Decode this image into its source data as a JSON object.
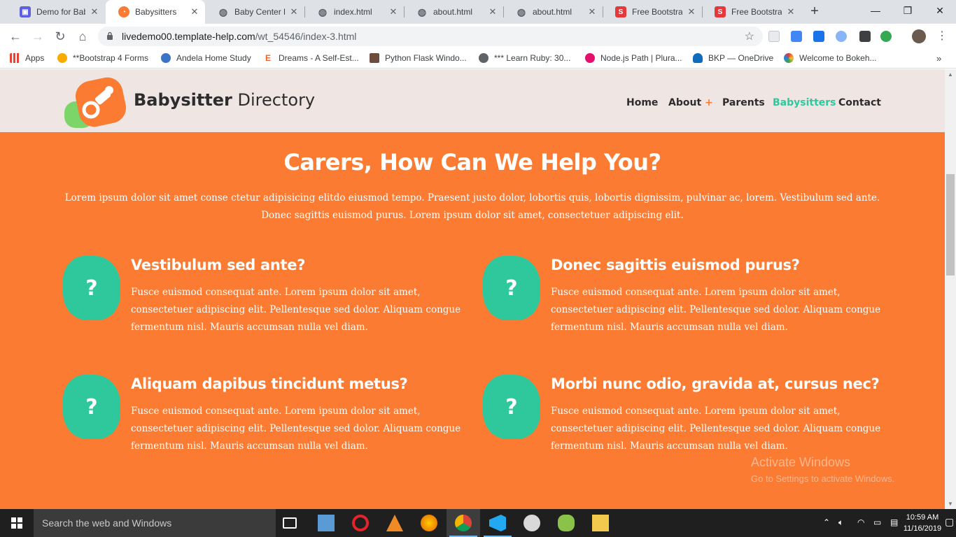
{
  "browser": {
    "tabs": [
      {
        "title": "Demo for Baby",
        "favicon": "template-icon",
        "color": "#5b5fe0"
      },
      {
        "title": "Babysitters",
        "favicon": "babysitter-logo-icon",
        "color": "#fb7b32",
        "active": true
      },
      {
        "title": "Baby Center D",
        "favicon": "globe-icon",
        "color": "#5f6368"
      },
      {
        "title": "index.html",
        "favicon": "globe-icon",
        "color": "#5f6368"
      },
      {
        "title": "about.html",
        "favicon": "globe-icon",
        "color": "#5f6368"
      },
      {
        "title": "about.html",
        "favicon": "globe-icon",
        "color": "#5f6368"
      },
      {
        "title": "Free Bootstrap",
        "favicon": "s-logo-icon",
        "color": "#e5383b"
      },
      {
        "title": "Free Bootstrap",
        "favicon": "s-logo-icon",
        "color": "#e5383b"
      }
    ],
    "url_host": "livedemo00.template-help.com",
    "url_path": "/wt_54546/index-3.html",
    "bookmarks": [
      {
        "label": "Apps",
        "icon": "apps-grid-icon"
      },
      {
        "label": "**Bootstrap 4 Forms",
        "icon": "search-icon"
      },
      {
        "label": "Andela Home Study",
        "icon": "gear-icon"
      },
      {
        "label": "Dreams - A Self-Est...",
        "icon": "e-icon"
      },
      {
        "label": "Python Flask Windo...",
        "icon": "avatar-icon"
      },
      {
        "label": "*** Learn Ruby: 30...",
        "icon": "globe-icon"
      },
      {
        "label": "Node.js Path | Plura...",
        "icon": "pluralsight-icon"
      },
      {
        "label": "BKP — OneDrive",
        "icon": "cloud-icon"
      },
      {
        "label": "Welcome to Bokeh...",
        "icon": "bokeh-icon"
      }
    ]
  },
  "site": {
    "brand_bold": "Babysitter",
    "brand_rest": " Directory",
    "nav": [
      {
        "label": "Home"
      },
      {
        "label": "About",
        "has_submenu": true
      },
      {
        "label": "Parents"
      },
      {
        "label": "Babysitters",
        "active": true
      },
      {
        "label": "Contact"
      }
    ],
    "submenu_marker": "+",
    "section_title": "Carers, How Can We Help You?",
    "section_text": "Lorem ipsum dolor sit amet conse ctetur adipisicing elitdo eiusmod tempo. Praesent justo dolor, lobortis quis, lobortis dignissim, pulvinar ac, lorem. Vestibulum sed ante. Donec sagittis euismod purus. Lorem ipsum dolor sit amet, consectetuer adipiscing elit.",
    "faq_icon": "?",
    "faqs": [
      {
        "title": "Vestibulum sed ante?",
        "text": "Fusce euismod consequat ante. Lorem ipsum dolor sit amet, consectetuer adipiscing elit. Pellentesque sed dolor. Aliquam congue fermentum nisl. Mauris accumsan nulla vel diam."
      },
      {
        "title": "Donec sagittis euismod purus?",
        "text": "Fusce euismod consequat ante. Lorem ipsum dolor sit amet, consectetuer adipiscing elit. Pellentesque sed dolor. Aliquam congue fermentum nisl. Mauris accumsan nulla vel diam."
      },
      {
        "title": "Aliquam dapibus tincidunt metus?",
        "text": "Fusce euismod consequat ante. Lorem ipsum dolor sit amet, consectetuer adipiscing elit. Pellentesque sed dolor. Aliquam congue fermentum nisl. Mauris accumsan nulla vel diam."
      },
      {
        "title": "Morbi nunc odio, gravida at, cursus nec?",
        "text": "Fusce euismod consequat ante. Lorem ipsum dolor sit amet, consectetuer adipiscing elit. Pellentesque sed dolor. Aliquam congue fermentum nisl. Mauris accumsan nulla vel diam."
      }
    ],
    "colors": {
      "orange": "#fb7b32",
      "teal": "#2ec89c",
      "header_bg": "#efe6e3"
    }
  },
  "windows": {
    "watermark_title": "Activate Windows",
    "watermark_text": "Go to Settings to activate Windows.",
    "search_placeholder": "Search the web and Windows",
    "time": "10:59 AM",
    "date": "11/16/2019"
  }
}
